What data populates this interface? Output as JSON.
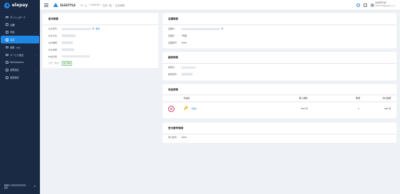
{
  "sidebar": {
    "logo": "elepay",
    "items": [
      {
        "label": "ダッシュボード",
        "chevron": "",
        "icon": "dashboard-icon"
      },
      {
        "label": "店舗",
        "chevron": "",
        "icon": "store-icon"
      },
      {
        "label": "商品",
        "chevron": "⌄",
        "icon": "product-icon"
      },
      {
        "label": "注文",
        "chevron": "",
        "icon": "order-icon",
        "active": true
      },
      {
        "label": "顧客",
        "beta": "(β版)",
        "chevron": "",
        "icon": "customer-icon"
      },
      {
        "label": "サービス設定",
        "chevron": "⌄",
        "icon": "settings-icon"
      },
      {
        "label": "Marketplace",
        "chevron": "",
        "icon": "marketplace-icon"
      },
      {
        "label": "連携設定",
        "chevron": "⌄",
        "icon": "integration-icon"
      },
      {
        "label": "登録設定",
        "chevron": "",
        "icon": "registration-icon"
      }
    ],
    "footer_label_1": "開発者",
    "footer_label_2": "設定",
    "footer_toggle": "⇄"
  },
  "topbar": {
    "store_name": "ELESTYLE",
    "breadcrumbs": [
      "ホーム",
      "tmo100",
      "注文一覧",
      "注文詳細"
    ],
    "breadcrumb_sep": "/",
    "user_name": "ELESTYLE",
    "user_sub": "ELESTYLE株式会社 テスト"
  },
  "basic": {
    "title": "基本情報",
    "labels": [
      "注文番号：",
      "注文方法：",
      "注文種類：",
      "注文金額：",
      "作成日時：",
      "ステータス："
    ],
    "copy_icon": "⧉",
    "refresh_link": "更新",
    "status": "完了済み"
  },
  "store_info": {
    "title": "店舗情報",
    "labels": [
      "店舗ID：",
      "店舗名：",
      "店舗番号："
    ],
    "store_name": "1号店",
    "store_number": "0001",
    "copy_icon": "⧉"
  },
  "customer": {
    "title": "顧客情報",
    "labels": [
      "顧客名：",
      "顧客番号："
    ]
  },
  "products": {
    "title": "商品情報",
    "headers": [
      "商品名",
      "購入価格",
      "数量",
      "合計金額"
    ],
    "rows": [
      {
        "name": "商品A",
        "price": "100 円",
        "qty": "1",
        "total": "100 円"
      }
    ]
  },
  "receipt": {
    "title": "受付番号情報",
    "label": "受付番号：",
    "value": "0001"
  }
}
